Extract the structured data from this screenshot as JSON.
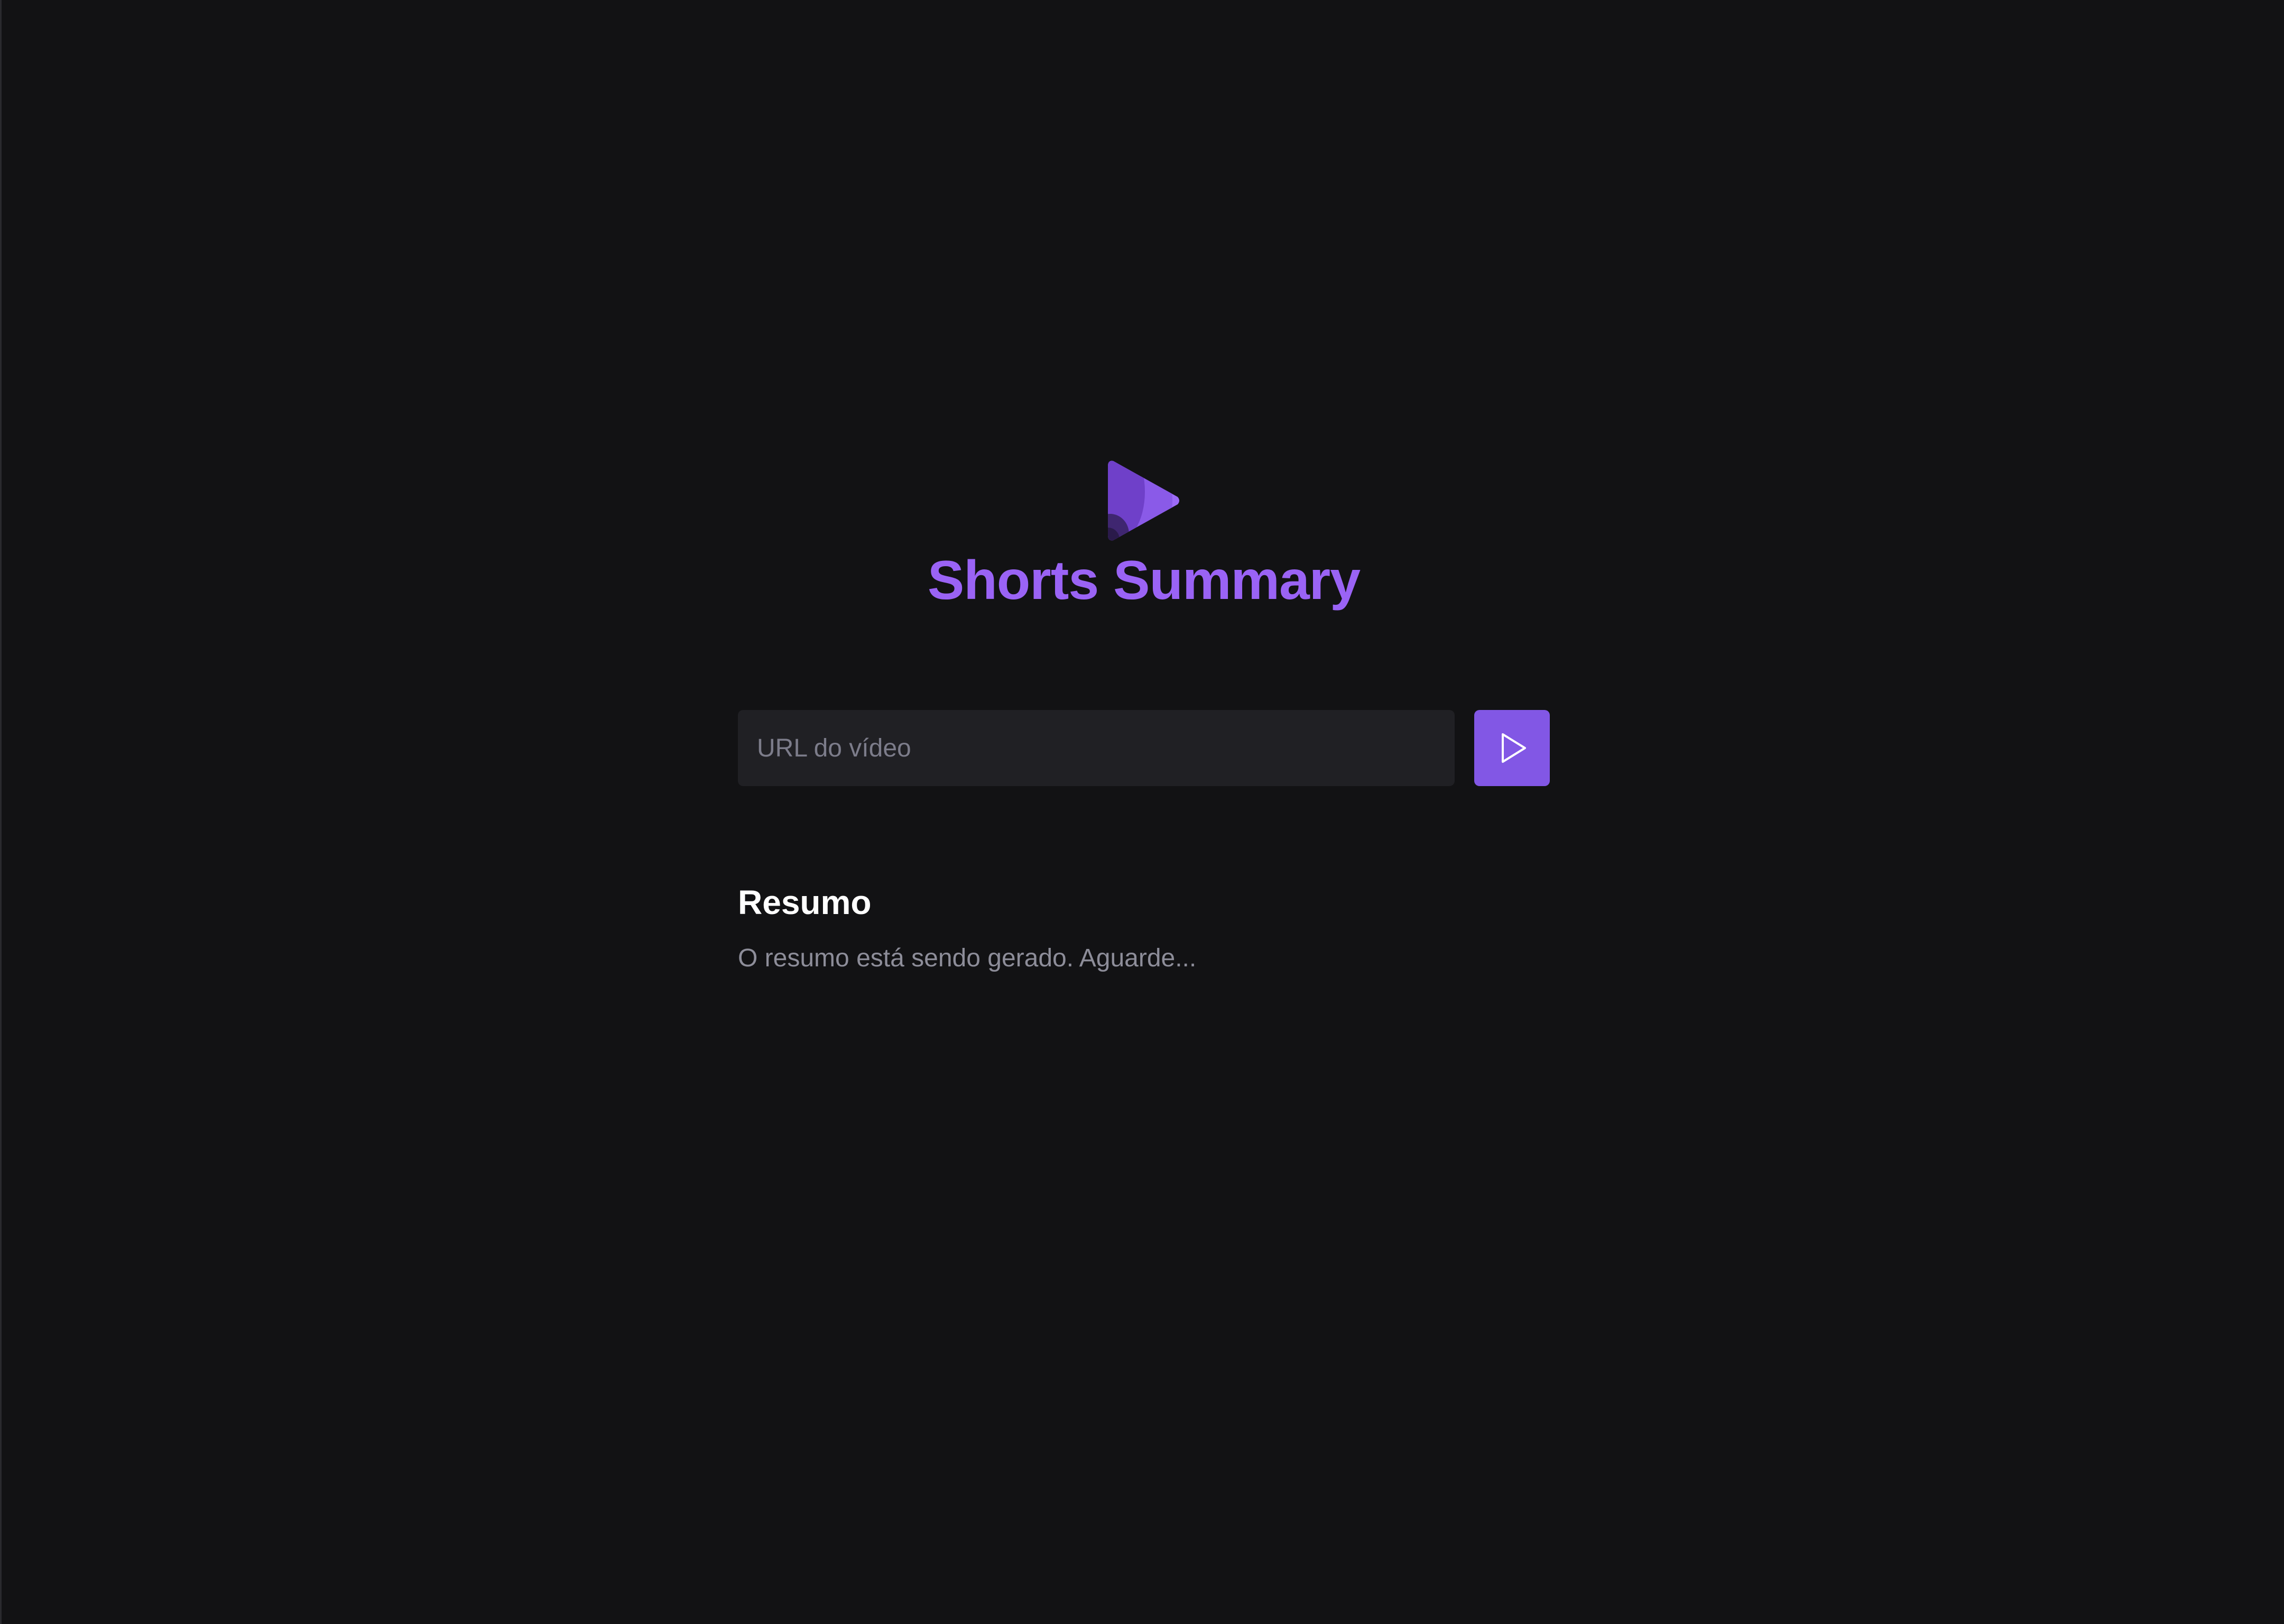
{
  "app": {
    "title": "Shorts Summary",
    "logo_icon": "play-logo-icon"
  },
  "form": {
    "url_placeholder": "URL do vídeo",
    "url_value": "",
    "submit_icon": "play-icon"
  },
  "summary": {
    "heading": "Resumo",
    "text": "O resumo está sendo gerado. Aguarde..."
  },
  "colors": {
    "background": "#121214",
    "accent": "#8257e5",
    "title": "#9a63f5",
    "input_background": "#202024",
    "placeholder": "#7c7c8a",
    "muted_text": "#8d8d99"
  }
}
